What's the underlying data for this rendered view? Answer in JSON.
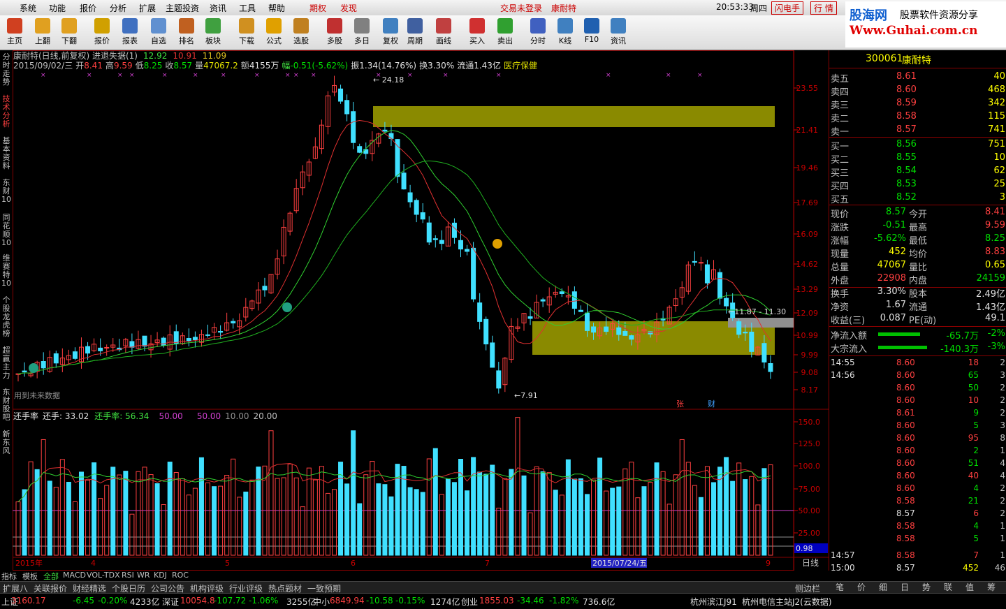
{
  "menu": {
    "items": [
      "系统",
      "功能",
      "报价",
      "分析",
      "扩展",
      "主题投资",
      "资讯",
      "工具",
      "帮助"
    ],
    "special": [
      "期权",
      "发现"
    ],
    "trade_status": "交易未登录",
    "stock_name": "康耐特",
    "time": "20:53:33",
    "weekday": "周四",
    "flash": "闪电手",
    "quote": "行 情"
  },
  "toolbar": {
    "buttons": [
      "主页",
      "上翻",
      "下翻",
      "报价",
      "报表",
      "自选",
      "排名",
      "板块",
      "下载",
      "公式",
      "选股",
      "多股",
      "多日",
      "复权",
      "周期",
      "画线",
      "买入",
      "卖出",
      "分时",
      "K线",
      "F10",
      "资讯"
    ]
  },
  "logo": {
    "line1": "股海网",
    "line2": "股票软件资源分享",
    "line3": "Www.Guhai.com.cn"
  },
  "leftnav": [
    "分时走势",
    "技术分析",
    "基本资料",
    "东财10",
    "同花顺10",
    "维赛特10",
    "个股龙虎榜",
    "超赢主力",
    "东财股吧",
    "新东风"
  ],
  "kline": {
    "title": "康耐特(日线,前复权) 进退失据(1)",
    "ind_values": [
      "12.92",
      "10.91",
      "11.09"
    ],
    "date": "2015/09/02/三",
    "open_label": "开",
    "open": "8.41",
    "high_label": "高",
    "high": "9.59",
    "low_label": "低",
    "low": "8.25",
    "close_label": "收",
    "close": "8.57",
    "vol_label": "量",
    "vol": "47067.2",
    "amt_label": "额",
    "amt": "4155万",
    "chg_label": "幅",
    "chg": "-0.51(-5.62%)",
    "amp": "振1.34(14.76%)",
    "turn": "换3.30%",
    "float": "流通1.43亿",
    "industry": "医疗保健",
    "high_mark": "24.18",
    "low_mark": "7.91",
    "range_mark": "11.87 - 11.30",
    "future_note": "用到未来数据",
    "marker_zhang": "张",
    "marker_cai": "财",
    "price_ticks": [
      "23.55",
      "21.41",
      "19.46",
      "17.69",
      "16.09",
      "14.62",
      "13.29",
      "12.09",
      "10.99",
      "9.99",
      "9.08",
      "8.17"
    ]
  },
  "turnover": {
    "title": "还手率",
    "label2": "还手: 33.02",
    "label3": "还手率: 56.34",
    "v4": "50.00",
    "v5": "50.00",
    "v6": "10.00",
    "v7": "20.00",
    "ticks": [
      "150.0",
      "125.0",
      "100.0",
      "75.00",
      "50.00",
      "25.00"
    ],
    "current": "0.98"
  },
  "xaxis": {
    "labels": [
      "2015年",
      "4",
      "5",
      "6",
      "7",
      "8",
      "9"
    ],
    "highlight": "2015/07/24/五",
    "period": "日线"
  },
  "quote": {
    "code": "300061",
    "name": "康耐特",
    "asks": [
      [
        "卖五",
        "8.61",
        "40"
      ],
      [
        "卖四",
        "8.60",
        "468"
      ],
      [
        "卖三",
        "8.59",
        "342"
      ],
      [
        "卖二",
        "8.58",
        "115"
      ],
      [
        "卖一",
        "8.57",
        "741"
      ]
    ],
    "bids": [
      [
        "买一",
        "8.56",
        "751"
      ],
      [
        "买二",
        "8.55",
        "10"
      ],
      [
        "买三",
        "8.54",
        "62"
      ],
      [
        "买四",
        "8.53",
        "25"
      ],
      [
        "买五",
        "8.52",
        "3"
      ]
    ],
    "stats": [
      [
        "现价",
        "8.57",
        "今开",
        "8.41"
      ],
      [
        "涨跌",
        "-0.51",
        "最高",
        "9.59"
      ],
      [
        "涨幅",
        "-5.62%",
        "最低",
        "8.25"
      ],
      [
        "现量",
        "452",
        "均价",
        "8.83"
      ],
      [
        "总量",
        "47067",
        "量比",
        "0.65"
      ],
      [
        "外盘",
        "22908",
        "内盘",
        "24159"
      ],
      [
        "换手",
        "3.30%",
        "股本",
        "2.49亿"
      ],
      [
        "净资",
        "1.67",
        "流通",
        "1.43亿"
      ],
      [
        "收益(三)",
        "0.087",
        "PE(动)",
        "49.1"
      ]
    ],
    "flows": [
      [
        "净流入额",
        "-65.7万",
        "-2%"
      ],
      [
        "大宗流入",
        "-140.3万",
        "-3%"
      ]
    ],
    "ticks": [
      [
        "14:55",
        "8.60",
        "18",
        "2"
      ],
      [
        "14:56",
        "8.60",
        "65",
        "3"
      ],
      [
        "",
        "8.60",
        "50",
        "2"
      ],
      [
        "",
        "8.60",
        "10",
        "2"
      ],
      [
        "",
        "8.61",
        "9",
        "2"
      ],
      [
        "",
        "8.60",
        "5",
        "3"
      ],
      [
        "",
        "8.60",
        "95",
        "8"
      ],
      [
        "",
        "8.60",
        "2",
        "1"
      ],
      [
        "",
        "8.60",
        "51",
        "4"
      ],
      [
        "",
        "8.60",
        "40",
        "4"
      ],
      [
        "",
        "8.60",
        "4",
        "2"
      ],
      [
        "",
        "8.58",
        "21",
        "2"
      ],
      [
        "",
        "8.57",
        "6",
        "2"
      ],
      [
        "",
        "8.58",
        "4",
        "1"
      ],
      [
        "",
        "8.58",
        "5",
        "1"
      ],
      [
        "14:57",
        "8.58",
        "7",
        "1"
      ],
      [
        "15:00",
        "8.57",
        "452",
        "46"
      ]
    ]
  },
  "bottomtabs": [
    "指标",
    "模板",
    "全部",
    "MACD",
    "VOL-TDX",
    "RSI",
    "WR",
    "KDJ",
    "ROC"
  ],
  "rightbottomtabs": [
    "笔",
    "价",
    "细",
    "日",
    "势",
    "联",
    "值",
    "筹"
  ],
  "funcbar": [
    "扩展八",
    "关联报价",
    "财经精选",
    "个股日历",
    "公司公告",
    "机构评级",
    "行业评级",
    "热点题材",
    "一致预期"
  ],
  "sidebar_label": "侧边栏",
  "status": {
    "sh_label": "上证",
    "sh": "3160.17",
    "sh_chg": "-6.45",
    "sh_pct": "-0.20%",
    "sh_amt": "4233亿",
    "sz_label": "深证",
    "sz": "10054.8",
    "sz_chg": "-107.72",
    "sz_pct": "-1.06%",
    "sz_amt": "3255亿",
    "zx_label": "中小",
    "zx": "6849.94",
    "zx_chg": "-10.58",
    "zx_pct": "-0.15%",
    "zx_amt": "1274亿",
    "cy_label": "创业",
    "cy": "1855.03",
    "cy_chg": "-34.46",
    "cy_pct": "-1.82%",
    "cy_amt": "736.6亿",
    "server1": "杭州滨江J91",
    "server2": "杭州电信主站J2(云数据)"
  },
  "colors": {
    "up": "#ff4040",
    "down": "#40e0ff",
    "zone": "#8a8a00",
    "ma_red": "#e03030",
    "ma_green": "#30d030"
  }
}
